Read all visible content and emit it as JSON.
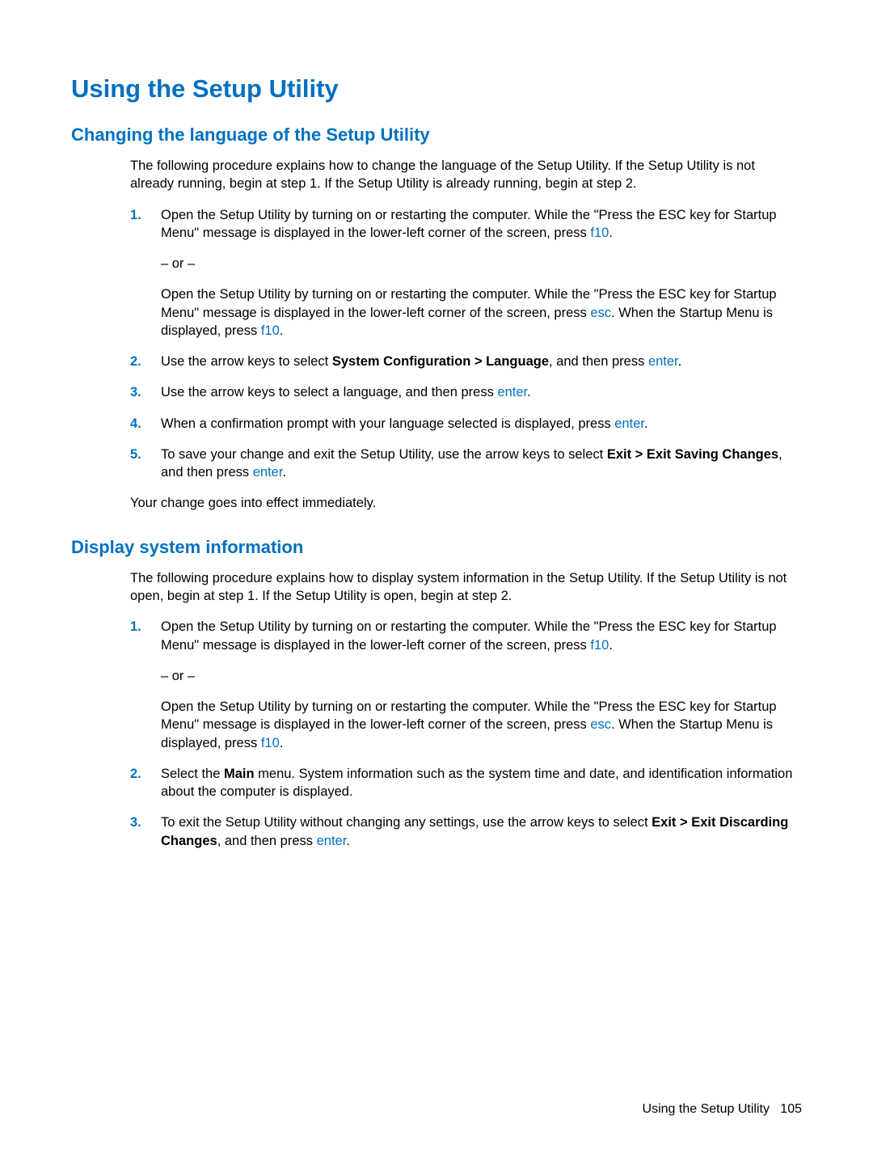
{
  "heading": "Using the Setup Utility",
  "section1": {
    "title": "Changing the language of the Setup Utility",
    "intro": "The following procedure explains how to change the language of the Setup Utility. If the Setup Utility is not already running, begin at step 1. If the Setup Utility is already running, begin at step 2.",
    "steps": {
      "s1": {
        "num": "1.",
        "p1a": "Open the Setup Utility by turning on or restarting the computer. While the \"Press the ESC key for Startup Menu\" message is displayed in the lower-left corner of the screen, press ",
        "p1key": "f10",
        "p1b": ".",
        "or": "– or –",
        "p2a": "Open the Setup Utility by turning on or restarting the computer. While the \"Press the ESC key for Startup Menu\" message is displayed in the lower-left corner of the screen, press ",
        "p2key1": "esc",
        "p2b": ". When the Startup Menu is displayed, press ",
        "p2key2": "f10",
        "p2c": "."
      },
      "s2": {
        "num": "2.",
        "a": "Use the arrow keys to select ",
        "bold": "System Configuration > Language",
        "b": ", and then press ",
        "key": "enter",
        "c": "."
      },
      "s3": {
        "num": "3.",
        "a": "Use the arrow keys to select a language, and then press ",
        "key": "enter",
        "b": "."
      },
      "s4": {
        "num": "4.",
        "a": "When a confirmation prompt with your language selected is displayed, press ",
        "key": "enter",
        "b": "."
      },
      "s5": {
        "num": "5.",
        "a": "To save your change and exit the Setup Utility, use the arrow keys to select ",
        "bold": "Exit > Exit Saving Changes",
        "b": ", and then press ",
        "key": "enter",
        "c": "."
      }
    },
    "closing": "Your change goes into effect immediately."
  },
  "section2": {
    "title": "Display system information",
    "intro": "The following procedure explains how to display system information in the Setup Utility. If the Setup Utility is not open, begin at step 1. If the Setup Utility is open, begin at step 2.",
    "steps": {
      "s1": {
        "num": "1.",
        "p1a": "Open the Setup Utility by turning on or restarting the computer. While the \"Press the ESC key for Startup Menu\" message is displayed in the lower-left corner of the screen, press ",
        "p1key": "f10",
        "p1b": ".",
        "or": "– or –",
        "p2a": "Open the Setup Utility by turning on or restarting the computer. While the \"Press the ESC key for Startup Menu\" message is displayed in the lower-left corner of the screen, press ",
        "p2key1": "esc",
        "p2b": ". When the Startup Menu is displayed, press ",
        "p2key2": "f10",
        "p2c": "."
      },
      "s2": {
        "num": "2.",
        "a": "Select the ",
        "bold": "Main",
        "b": " menu. System information such as the system time and date, and identification information about the computer is displayed."
      },
      "s3": {
        "num": "3.",
        "a": "To exit the Setup Utility without changing any settings, use the arrow keys to select ",
        "bold": "Exit > Exit Discarding Changes",
        "b": ", and then press ",
        "key": "enter",
        "c": "."
      }
    }
  },
  "footer": {
    "text": "Using the Setup Utility",
    "page": "105"
  }
}
